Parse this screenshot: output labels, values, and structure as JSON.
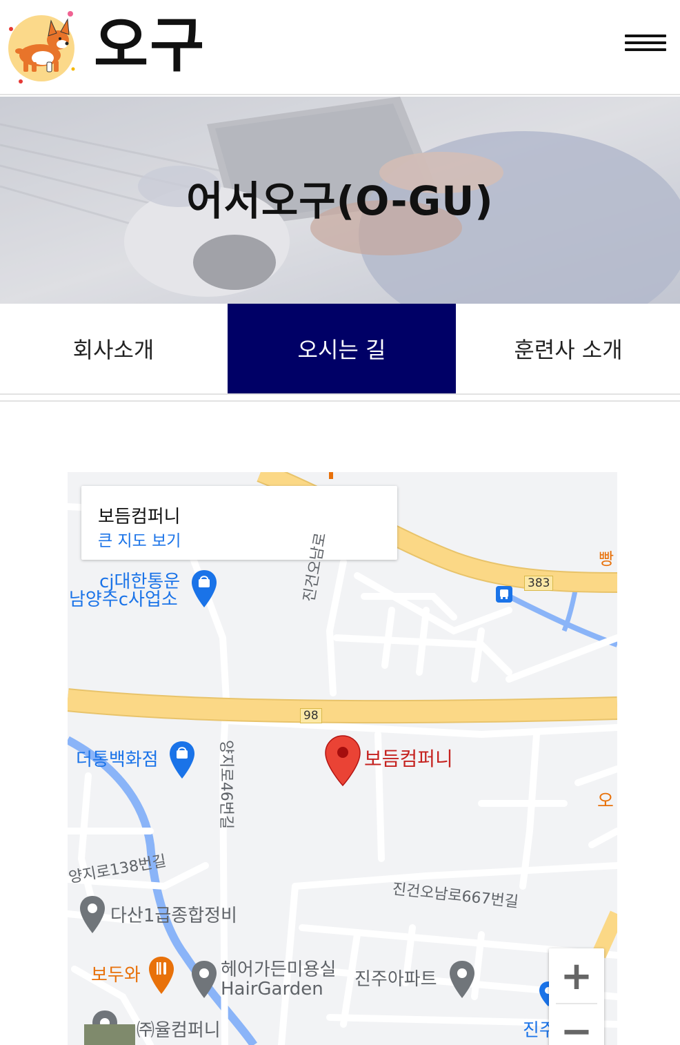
{
  "header": {
    "brand": "오구",
    "logo_icon": "corgi-logo-icon",
    "menu_icon": "hamburger-menu-icon"
  },
  "hero": {
    "title": "어서오구(O-GU)"
  },
  "tabs": [
    {
      "label": "회사소개",
      "active": false
    },
    {
      "label": "오시는 길",
      "active": true
    },
    {
      "label": "훈련사 소개",
      "active": false
    }
  ],
  "map": {
    "info_card": {
      "title": "보듬컴퍼니",
      "link": "큰 지도 보기"
    },
    "marker_label": "보듬컴퍼니",
    "road_shields": [
      "383",
      "98"
    ],
    "places": {
      "cj_line1": "cj대한통운",
      "cj_line2": "남양주c사업소",
      "department_store": "더통백화점",
      "repair_shop": "다산1급종합정비",
      "restaurant": "보두와",
      "salon_line1": "헤어가든미용실",
      "salon_line2": "HairGarden",
      "apartment": "진주아파트",
      "company": "㈜율컴퍼니",
      "bakery_partial": "빵",
      "partial_right": "오",
      "partial_bottom": "진주"
    },
    "streets": {
      "vertical_top": "진건오남로",
      "vertical_mid": "양지로46번길",
      "diag_left": "양지로138번길",
      "diag_right": "진건오남로667번길"
    },
    "zoom": {
      "in": "+",
      "out": "−"
    },
    "colors": {
      "background": "#f2f3f5",
      "major_road": "#fbd886",
      "minor_road": "#ffffff",
      "water": "#8ab4f8",
      "marker": "#ea4335",
      "place_blue": "#1a73e8",
      "place_orange": "#e8710a"
    }
  },
  "colors": {
    "active_tab": "#000066"
  }
}
